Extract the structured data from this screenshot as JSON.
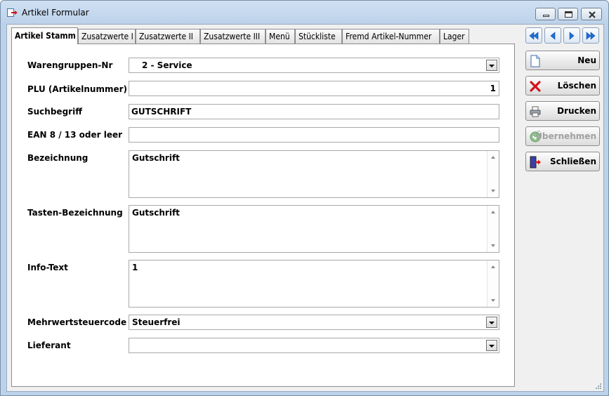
{
  "window": {
    "title": "Artikel Formular"
  },
  "tabs": [
    {
      "label": "Artikel Stamm",
      "active": true
    },
    {
      "label": "Zusatzwerte I"
    },
    {
      "label": "Zusatzwerte II"
    },
    {
      "label": "Zusatzwerte III"
    },
    {
      "label": "Menü"
    },
    {
      "label": "Stückliste"
    },
    {
      "label": "Fremd Artikel-Nummer"
    },
    {
      "label": "Lager"
    }
  ],
  "form": {
    "warengruppe": {
      "label": "Warengruppen-Nr",
      "value": "2 - Service"
    },
    "plu": {
      "label": "PLU (Artikelnummer)",
      "value": "1"
    },
    "suchbegriff": {
      "label": "Suchbegriff",
      "value": "GUTSCHRIFT"
    },
    "ean": {
      "label": "EAN 8 / 13 oder leer",
      "value": ""
    },
    "bezeichnung": {
      "label": "Bezeichnung",
      "value": "Gutschrift"
    },
    "tasten": {
      "label": "Tasten-Bezeichnung",
      "value": "Gutschrift"
    },
    "info": {
      "label": "Info-Text",
      "value": "1"
    },
    "mwst": {
      "label": "Mehrwertsteuercode",
      "value": "Steuerfrei"
    },
    "lieferant": {
      "label": "Lieferant",
      "value": ""
    }
  },
  "actions": {
    "neu": "Neu",
    "loeschen": "Löschen",
    "drucken": "Drucken",
    "uebernehmen": "Übernehmen",
    "schliessen": "Schließen"
  },
  "nav_icons": [
    "first-record-icon",
    "previous-record-icon",
    "next-record-icon",
    "last-record-icon"
  ],
  "colors": {
    "nav_arrow": "#1f6fd6",
    "delete_x": "#d2141b"
  }
}
